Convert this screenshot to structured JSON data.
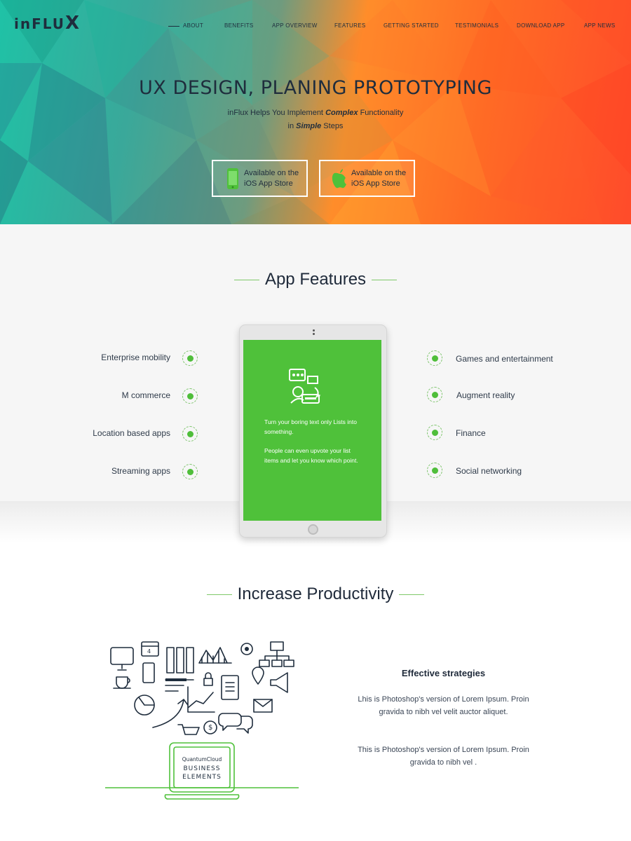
{
  "brand": {
    "logo_text": "inFLU",
    "logo_mark": "X"
  },
  "nav": {
    "items": [
      "ABOUT",
      "BENEFITS",
      "APP OVERVIEW",
      "FEATURES",
      "GETTING STARTED",
      "TESTIMONIALS",
      "DOWNLOAD APP",
      "APP NEWS"
    ]
  },
  "hero": {
    "title": "UX DESIGN, PLANING PROTOTYPING",
    "sub_line1_a": "inFlux Helps You Implement ",
    "sub_line1_b": "Complex",
    "sub_line1_c": " Functionality",
    "sub_line2_a": "in ",
    "sub_line2_b": "Simple",
    "sub_line2_c": " Steps",
    "buttons": [
      {
        "line1": "Available on the",
        "line2": "iOS App Store",
        "icon": "phone-icon"
      },
      {
        "line1": "Available on the",
        "line2": "iOS App Store",
        "icon": "apple-icon"
      }
    ]
  },
  "features": {
    "title": "App Features",
    "left": [
      "Enterprise mobility",
      "M commerce",
      "Location based apps",
      "Streaming apps"
    ],
    "right": [
      "Games and entertainment",
      "Augment reality",
      "Finance",
      "Social networking"
    ],
    "tablet_text1": "Turn your boring text only Lists into something.",
    "tablet_text2": "People can even upvote your list items and let you know which point."
  },
  "productivity": {
    "title": "Increase Productivity",
    "illustration_brand": "QuantumCloud",
    "illustration_line1": "BUSINESS",
    "illustration_line2": "ELEMENTS",
    "calendar_day": "4",
    "strategy_title": "Effective strategies",
    "para1": "Lhis is Photoshop's version  of Lorem Ipsum. Proin gravida to nibh vel velit auctor aliquet.",
    "para2": "This is Photoshop's version  of Lorem Ipsum. Proin gravida to nibh vel ."
  },
  "colors": {
    "accent_green": "#4fc13a",
    "hero_teal": "#1fc2a6",
    "hero_orange": "#ff6b25",
    "text_dark": "#1f2a3a"
  }
}
